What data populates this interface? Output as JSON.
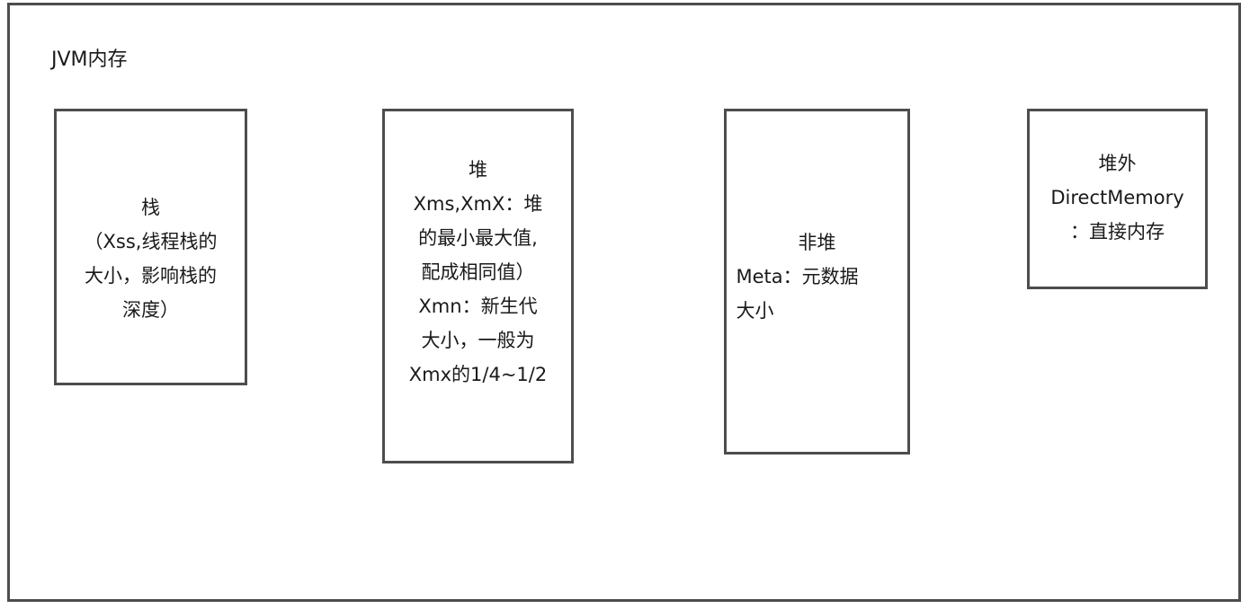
{
  "diagram": {
    "title": "JVM内存",
    "boxes": {
      "stack": {
        "lines": [
          "栈",
          "（Xss,线程栈的",
          "大小，影响栈的",
          "深度）"
        ]
      },
      "heap": {
        "lines": [
          "堆",
          "Xms,XmX：堆",
          "的最小最大值,",
          "配成相同值）",
          "Xmn：新生代",
          "大小，一般为",
          "Xmx的1/4~1/2"
        ]
      },
      "nonheap": {
        "lines": [
          "非堆",
          "Meta：元数据",
          "大小"
        ]
      },
      "offheap": {
        "lines": [
          "堆外",
          "DirectMemory",
          "：直接内存"
        ]
      }
    },
    "colors": {
      "border": "#4d4d4d",
      "text": "#1a1a1a",
      "background": "#ffffff"
    }
  }
}
